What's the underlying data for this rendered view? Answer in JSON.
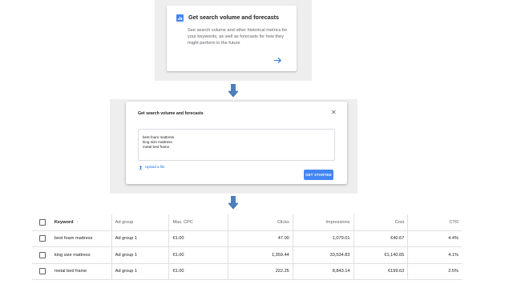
{
  "card": {
    "title": "Get search volume and forecasts",
    "description": "See search volume and other historical metrics for your keywords, as well as forecasts for how they might perform in the future"
  },
  "dialog": {
    "title": "Get search volume and forecasts",
    "keywords": [
      "best foam mattress",
      "king size mattress",
      "metal bed frame"
    ],
    "upload_label": "Upload a file",
    "submit_label": "GET STARTED"
  },
  "table": {
    "headers": {
      "keyword": "Keyword",
      "ad_group": "Ad group",
      "max_cpc": "Max. CPC",
      "clicks": "Clicks",
      "impressions": "Impressions",
      "cost": "Cost",
      "ctr": "CTR"
    },
    "rows": [
      {
        "keyword": "best foam mattress",
        "ad_group": "Ad group 1",
        "max_cpc": "€1.00",
        "clicks": "47.00",
        "impressions": "1,079.01",
        "cost": "€40.67",
        "ctr": "4.4%"
      },
      {
        "keyword": "king size mattress",
        "ad_group": "Ad group 1",
        "max_cpc": "€1.00",
        "clicks": "1,359.44",
        "impressions": "33,534.83",
        "cost": "€1,140.65",
        "ctr": "4.1%"
      },
      {
        "keyword": "metal bed frame",
        "ad_group": "Ad group 1",
        "max_cpc": "€1.00",
        "clicks": "222.25",
        "impressions": "8,843.14",
        "cost": "€199.63",
        "ctr": "2.5%"
      }
    ]
  },
  "colors": {
    "accent": "#4285f4",
    "link": "#1a73e8",
    "arrow": "#3a6ea5"
  }
}
